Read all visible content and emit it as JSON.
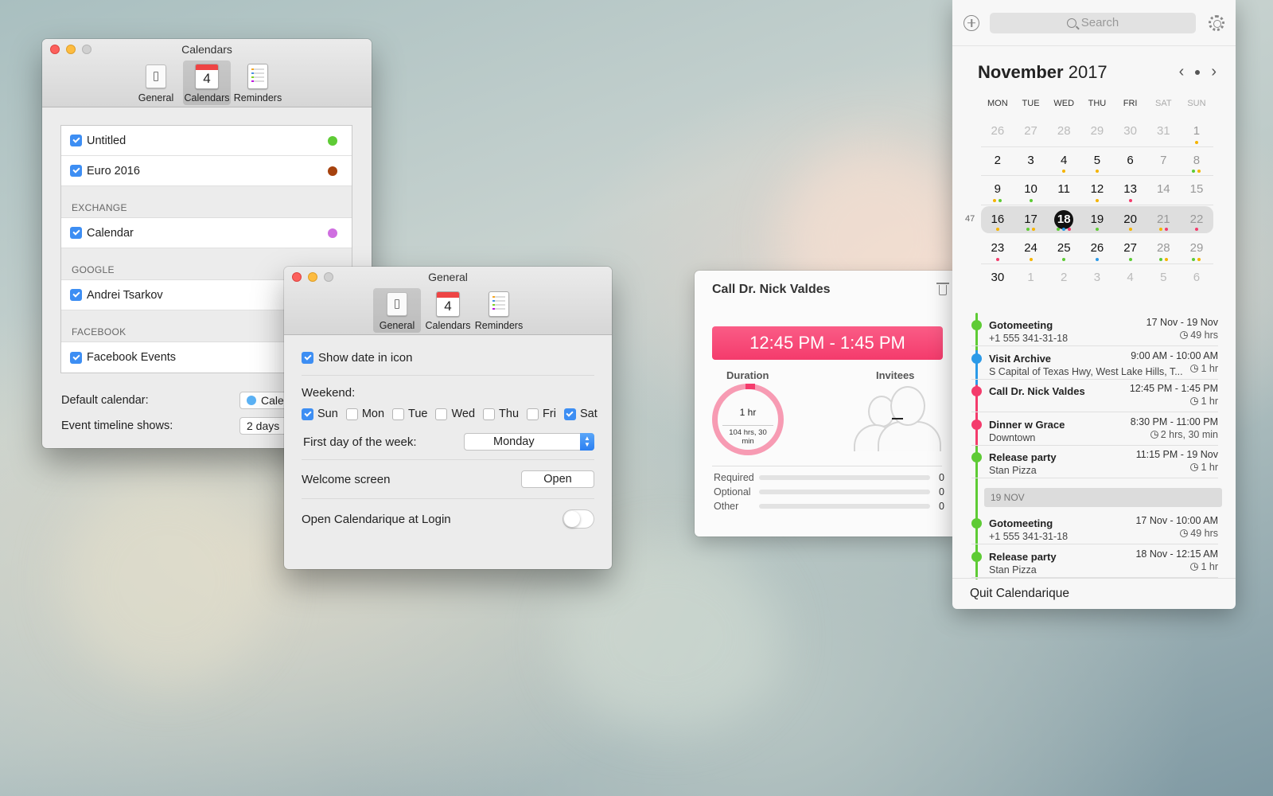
{
  "calendars_window": {
    "title": "Calendars",
    "tabs": [
      {
        "label": "General"
      },
      {
        "label": "Calendars",
        "icon_number": "4"
      },
      {
        "label": "Reminders"
      }
    ],
    "items": [
      {
        "label": "Untitled",
        "color": "#5ecb35"
      },
      {
        "label": "Euro 2016",
        "color": "#a6420e"
      }
    ],
    "groups": [
      {
        "name": "EXCHANGE",
        "items": [
          {
            "label": "Calendar",
            "color": "#cf6ee0"
          }
        ]
      },
      {
        "name": "GOOGLE",
        "items": [
          {
            "label": "Andrei Tsarkov"
          }
        ]
      },
      {
        "name": "FACEBOOK",
        "items": [
          {
            "label": "Facebook Events"
          }
        ]
      }
    ],
    "default_calendar_label": "Default calendar:",
    "default_calendar_value": "Cale",
    "timeline_label": "Event timeline shows:",
    "timeline_value": "2 days"
  },
  "general_window": {
    "title": "General",
    "tabs": [
      {
        "label": "General"
      },
      {
        "label": "Calendars",
        "icon_number": "4"
      },
      {
        "label": "Reminders"
      }
    ],
    "show_date_label": "Show date in icon",
    "weekend_label": "Weekend:",
    "days": [
      {
        "label": "Sun",
        "checked": true
      },
      {
        "label": "Mon",
        "checked": false
      },
      {
        "label": "Tue",
        "checked": false
      },
      {
        "label": "Wed",
        "checked": false
      },
      {
        "label": "Thu",
        "checked": false
      },
      {
        "label": "Fri",
        "checked": false
      },
      {
        "label": "Sat",
        "checked": true
      }
    ],
    "first_day_label": "First day of the week:",
    "first_day_value": "Monday",
    "welcome_label": "Welcome screen",
    "welcome_button": "Open",
    "login_label": "Open Calendarique at Login"
  },
  "popover": {
    "title": "Call Dr. Nick Valdes",
    "time_range": "12:45 PM - 1:45 PM",
    "duration_head": "Duration",
    "invitees_head": "Invitees",
    "duration_value": "1 hr",
    "duration_sub": "104 hrs, 30 min",
    "attendance": [
      {
        "label": "Required",
        "count": "0"
      },
      {
        "label": "Optional",
        "count": "0"
      },
      {
        "label": "Other",
        "count": "0"
      }
    ],
    "accent": "#f43b6c"
  },
  "panel": {
    "search_placeholder": "Search",
    "month": "November",
    "year": "2017",
    "weekdays": [
      "MON",
      "TUE",
      "WED",
      "THU",
      "FRI",
      "SAT",
      "SUN"
    ],
    "selected_week_number": "47",
    "weeks": [
      [
        {
          "d": "26",
          "m": true
        },
        {
          "d": "27",
          "m": true
        },
        {
          "d": "28",
          "m": true
        },
        {
          "d": "29",
          "m": true
        },
        {
          "d": "30",
          "m": true
        },
        {
          "d": "31",
          "m": true
        },
        {
          "d": "1",
          "dots": [
            "#f5b400"
          ]
        }
      ],
      [
        {
          "d": "2"
        },
        {
          "d": "3"
        },
        {
          "d": "4",
          "dots": [
            "#f5b400"
          ]
        },
        {
          "d": "5",
          "dots": [
            "#f5b400"
          ]
        },
        {
          "d": "6"
        },
        {
          "d": "7"
        },
        {
          "d": "8",
          "dots": [
            "#5ecb35",
            "#f5b400"
          ]
        }
      ],
      [
        {
          "d": "9",
          "dots": [
            "#f5b400",
            "#5ecb35"
          ]
        },
        {
          "d": "10",
          "dots": [
            "#5ecb35"
          ]
        },
        {
          "d": "11"
        },
        {
          "d": "12",
          "dots": [
            "#f5b400"
          ]
        },
        {
          "d": "13",
          "dots": [
            "#f43b6c"
          ]
        },
        {
          "d": "14"
        },
        {
          "d": "15"
        }
      ],
      [
        {
          "d": "16",
          "dots": [
            "#f5b400"
          ]
        },
        {
          "d": "17",
          "dots": [
            "#5ecb35",
            "#f5b400"
          ]
        },
        {
          "d": "18",
          "today": true,
          "dots": [
            "#5ecb35",
            "#2b9ae8",
            "#f43b6c"
          ]
        },
        {
          "d": "19",
          "dots": [
            "#5ecb35"
          ]
        },
        {
          "d": "20",
          "dots": [
            "#f5b400"
          ]
        },
        {
          "d": "21",
          "dots": [
            "#f5b400",
            "#f43b6c"
          ]
        },
        {
          "d": "22",
          "dots": [
            "#f43b6c"
          ]
        }
      ],
      [
        {
          "d": "23",
          "dots": [
            "#f43b6c"
          ]
        },
        {
          "d": "24",
          "dots": [
            "#f5b400"
          ]
        },
        {
          "d": "25",
          "dots": [
            "#5ecb35"
          ]
        },
        {
          "d": "26",
          "dots": [
            "#2b9ae8"
          ]
        },
        {
          "d": "27",
          "dots": [
            "#5ecb35"
          ]
        },
        {
          "d": "28",
          "dots": [
            "#5ecb35",
            "#f5b400"
          ]
        },
        {
          "d": "29",
          "dots": [
            "#5ecb35",
            "#f5b400"
          ]
        }
      ],
      [
        {
          "d": "30"
        },
        {
          "d": "1",
          "m": true
        },
        {
          "d": "2",
          "m": true
        },
        {
          "d": "3",
          "m": true
        },
        {
          "d": "4",
          "m": true
        },
        {
          "d": "5",
          "m": true
        },
        {
          "d": "6",
          "m": true
        }
      ]
    ],
    "events": [
      {
        "title": "Gotomeeting",
        "sub": "+1 555 341-31-18",
        "time": "17 Nov - 19 Nov",
        "dur": "49 hrs",
        "color": "#5ecb35"
      },
      {
        "title": "Visit Archive",
        "sub": "S Capital of Texas Hwy, West Lake Hills, T...",
        "time": "9:00 AM - 10:00 AM",
        "dur": "1 hr",
        "color": "#2b9ae8"
      },
      {
        "title": "Call Dr. Nick Valdes",
        "sub": "",
        "time": "12:45 PM - 1:45 PM",
        "dur": "1 hr",
        "color": "#f43b6c"
      },
      {
        "title": "Dinner w Grace",
        "sub": "Downtown",
        "time": "8:30 PM - 11:00 PM",
        "dur": "2 hrs, 30 min",
        "color": "#f43b6c"
      },
      {
        "title": "Release party",
        "sub": "Stan Pizza",
        "time": "11:15 PM - 19 Nov",
        "dur": "1 hr",
        "color": "#5ecb35"
      }
    ],
    "day_band": "19 NOV",
    "events2": [
      {
        "title": "Gotomeeting",
        "sub": "+1 555 341-31-18",
        "time": "17 Nov - 10:00 AM",
        "dur": "49 hrs",
        "color": "#5ecb35"
      },
      {
        "title": "Release party",
        "sub": "Stan Pizza",
        "time": "18 Nov - 12:15 AM",
        "dur": "1 hr",
        "color": "#5ecb35"
      }
    ],
    "quit_label": "Quit Calendarique"
  }
}
